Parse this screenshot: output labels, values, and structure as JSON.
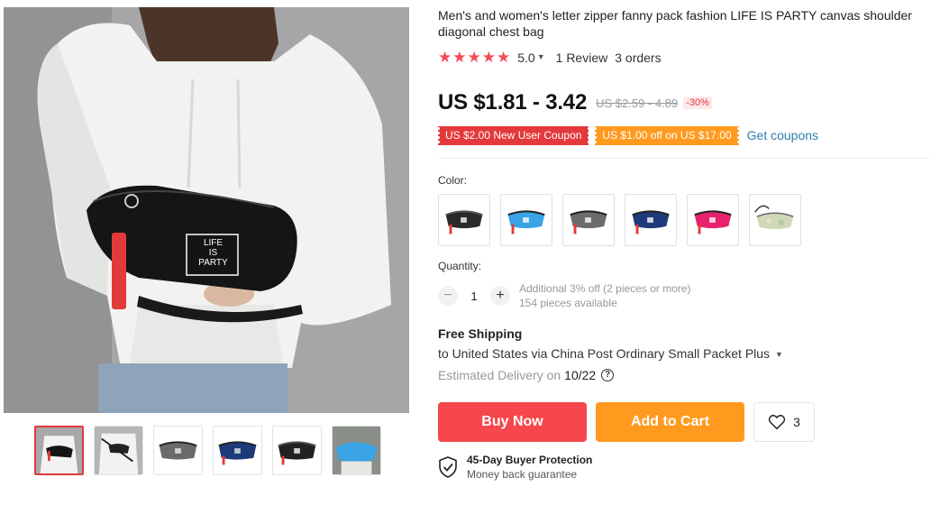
{
  "product": {
    "title": "Men's and women's letter zipper fanny pack fashion LIFE IS PARTY canvas shoulder diagonal chest bag",
    "rating": "5.0",
    "rating_stars": 5,
    "reviews": "1 Review",
    "orders": "3 orders",
    "bag_print": "LIFE IS PARTY"
  },
  "price": {
    "current": "US $1.81 - 3.42",
    "original": "US $2.59 - 4.89",
    "discount": "-30%"
  },
  "coupons": [
    {
      "label": "US $2.00 New User Coupon",
      "color": "#e4393c"
    },
    {
      "label": "US $1.00 off on US $17.00",
      "color": "#ff9a1f"
    }
  ],
  "get_coupons": "Get coupons",
  "color_label": "Color:",
  "swatches": [
    {
      "color": "#2a2a2a",
      "name": "black"
    },
    {
      "color": "#39a3e3",
      "name": "sky-blue"
    },
    {
      "color": "#6b6b6b",
      "name": "gray"
    },
    {
      "color": "#1d3a7a",
      "name": "navy"
    },
    {
      "color": "#e8216c",
      "name": "rose-red"
    },
    {
      "color": "#cfd8b8",
      "name": "holographic"
    }
  ],
  "quantity": {
    "label": "Quantity:",
    "value": "1",
    "note_line1": "Additional 3% off (2 pieces or more)",
    "note_line2": "154 pieces available"
  },
  "shipping": {
    "title": "Free Shipping",
    "to": "to United States via China Post Ordinary Small Packet Plus",
    "delivery_label": "Estimated Delivery on",
    "delivery_date": "10/22"
  },
  "actions": {
    "buy_now": "Buy Now",
    "add_to_cart": "Add to Cart",
    "wishlist_count": "3"
  },
  "protection": {
    "title": "45-Day Buyer Protection",
    "subtitle": "Money back guarantee"
  },
  "colors": {
    "accent_red": "#f6474c",
    "accent_orange": "#ff9a1f",
    "star": "#f44b55",
    "link": "#2f7cb0"
  }
}
